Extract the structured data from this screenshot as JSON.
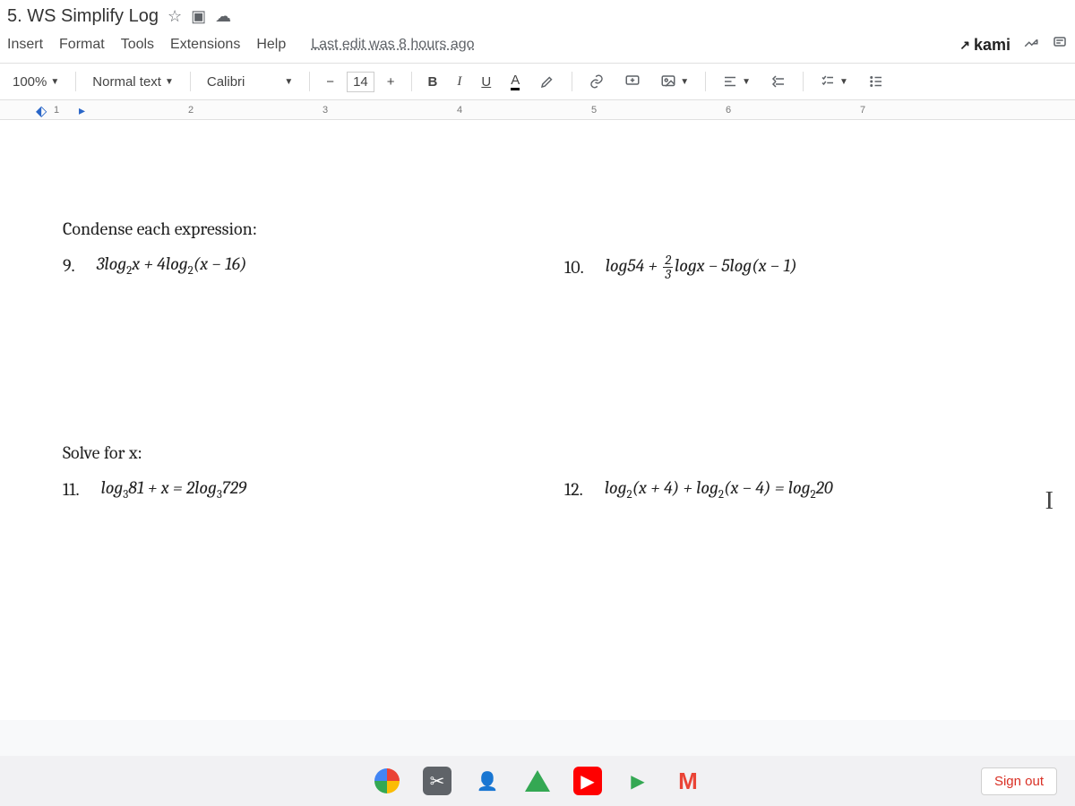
{
  "title": "5. WS Simplify Log",
  "menus": {
    "insert": "Insert",
    "format": "Format",
    "tools": "Tools",
    "extensions": "Extensions",
    "help": "Help",
    "last_edit": "Last edit was 8 hours ago"
  },
  "kami": {
    "external": "↗",
    "name": "kami"
  },
  "toolbar": {
    "zoom": "100%",
    "style": "Normal text",
    "font": "Calibri",
    "font_size": "14",
    "bold": "B",
    "italic": "I",
    "underline": "U",
    "text_color": "A"
  },
  "ruler": {
    "marks": [
      "1",
      "2",
      "3",
      "4",
      "5",
      "6",
      "7"
    ]
  },
  "document": {
    "heading1": "Condense each expression:",
    "heading2": "Solve for x:",
    "problems": {
      "p9": {
        "num": "9.",
        "expr": "3log₂x + 4log₂(x − 16)"
      },
      "p10": {
        "num": "10.",
        "prefix": "log54 + ",
        "frac_top": "2",
        "frac_bot": "3",
        "suffix": "logx − 5log(x − 1)"
      },
      "p11": {
        "num": "11.",
        "expr": "log₃81 + x = 2log₃729"
      },
      "p12": {
        "num": "12.",
        "expr": "log₂(x + 4) + log₂(x − 4) = log₂20"
      }
    }
  },
  "signout": "Sign out"
}
